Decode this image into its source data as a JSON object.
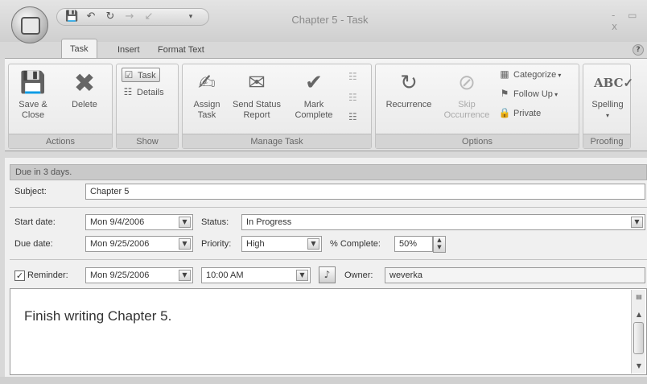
{
  "window": {
    "title": "Chapter 5 - Task",
    "controls": "- ▭ x"
  },
  "office_button": {
    "label": "O"
  },
  "qat": {
    "icons": [
      "save-icon",
      "undo-icon",
      "redo-icon",
      "back-icon",
      "forward-icon",
      "customize-icon"
    ]
  },
  "tabs": [
    "Task",
    "Insert",
    "Format Text"
  ],
  "ribbon": {
    "actions": {
      "label": "Actions",
      "save_close": "Save & Close",
      "delete": "Delete"
    },
    "show": {
      "label": "Show",
      "task": "Task",
      "details": "Details"
    },
    "manage_task": {
      "label": "Manage Task",
      "assign_task": "Assign Task",
      "send_status_report": "Send Status Report",
      "mark_complete": "Mark Complete"
    },
    "options": {
      "label": "Options",
      "recurrence": "Recurrence",
      "skip_occurrence": "Skip Occurrence",
      "categorize": "Categorize",
      "follow_up": "Follow Up",
      "private": "Private"
    },
    "proofing": {
      "label": "Proofing",
      "spelling": "Spelling"
    }
  },
  "infobar": {
    "text": "Due in 3 days."
  },
  "form": {
    "subject_label": "Subject:",
    "subject_value": "Chapter 5",
    "start_date_label": "Start date:",
    "start_date_value": "Mon 9/4/2006",
    "status_label": "Status:",
    "status_value": "In Progress",
    "due_date_label": "Due date:",
    "due_date_value": "Mon 9/25/2006",
    "priority_label": "Priority:",
    "priority_value": "High",
    "percent_label": "% Complete:",
    "percent_value": "50%",
    "reminder_label": "Reminder:",
    "reminder_checked": true,
    "reminder_date": "Mon 9/25/2006",
    "reminder_time": "10:00 AM",
    "owner_label": "Owner:",
    "owner_value": "weverka"
  },
  "body": {
    "text": "Finish writing Chapter 5."
  }
}
